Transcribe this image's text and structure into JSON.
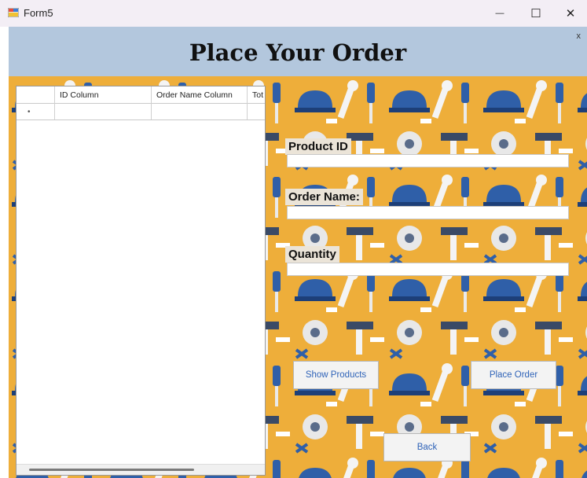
{
  "window": {
    "title": "Form5",
    "minimize_glyph": "—",
    "maximize_glyph": "☐",
    "close_glyph": "✕"
  },
  "header": {
    "title": "Place Your Order",
    "close_text": "x"
  },
  "grid": {
    "columns": [
      "ID Column",
      "Order Name Column",
      "Tot"
    ],
    "new_row_marker": "•"
  },
  "form": {
    "product_id_label": "Product ID",
    "product_id_value": "",
    "order_name_label": "Order Name:",
    "order_name_value": "",
    "quantity_label": "Quantity",
    "quantity_value": ""
  },
  "buttons": {
    "show_products": "Show Products",
    "place_order": "Place Order",
    "back": "Back"
  },
  "colors": {
    "pattern_background": "#eeae3a",
    "header_background": "#b3c7dd",
    "tool_blue": "#2f5fa8",
    "button_text": "#2f63b8"
  }
}
